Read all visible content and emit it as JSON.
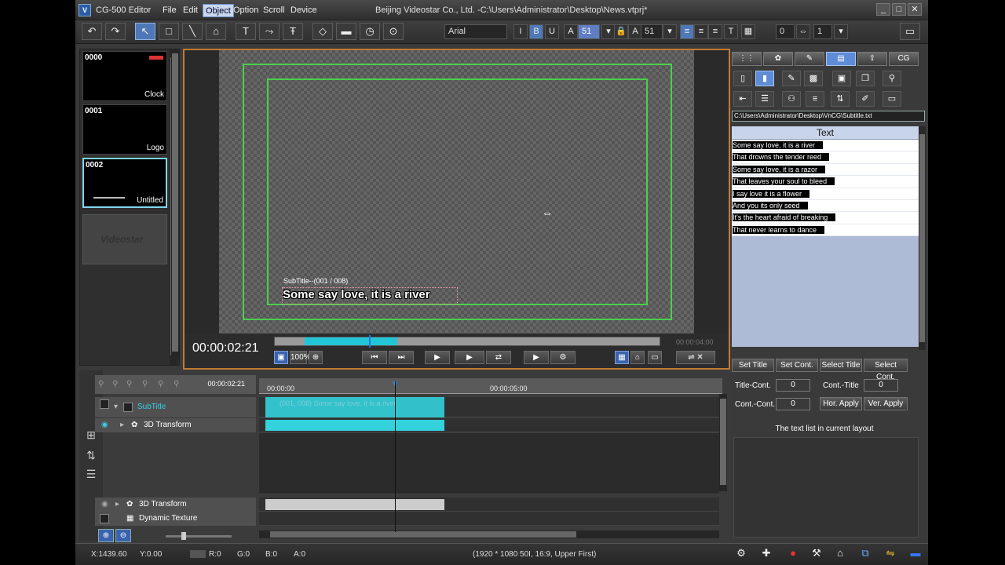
{
  "window": {
    "app_name": "CG-500 Editor",
    "doc_title": "Beijing Videostar Co., Ltd. -C:\\Users\\Administrator\\Desktop\\News.vtprj*",
    "menus": [
      "File",
      "Edit",
      "Object",
      "Option",
      "Scroll",
      "Device"
    ],
    "active_menu": "Object",
    "controls": [
      "_",
      "□",
      "✕"
    ]
  },
  "toolbar": {
    "font": "Arial",
    "bold": "B",
    "italic": "I",
    "underline": "U",
    "font_size_1": "51",
    "font_size_2": "51",
    "spacing": "0",
    "lines": "1"
  },
  "thumbnails": [
    {
      "num": "0000",
      "name": "Clock"
    },
    {
      "num": "0001",
      "name": "Logo"
    },
    {
      "num": "0002",
      "name": "Untitled"
    }
  ],
  "thumb_empty_logo": "Videostar",
  "preview": {
    "subtitle_label": "SubTitle--(001 / 008)",
    "subtitle_text": "Some say love, it is a river",
    "timecode": "00:00:02:21",
    "end_time": "00:00:04:00",
    "zoom": "100%"
  },
  "right_panel": {
    "tabs": [
      "",
      "",
      "",
      "",
      "",
      "CG"
    ],
    "path": "C:\\Users\\Administrator\\Desktop\\VnCG\\Subtitle.txt",
    "list_header": "Text",
    "text_rows": [
      "Some say love, it is a river",
      "That drowns the tender reed",
      "Some say love, it is a razor",
      "That leaves your soul to bleed",
      "I say love it is a flower",
      "And you its only seed",
      "It's the heart afraid of breaking",
      "That never learns to dance"
    ]
  },
  "controls": {
    "set_title": "Set Title",
    "set_cont": "Set Cont.",
    "select_title": "Select Title",
    "select_cont": "Select Cont.",
    "title_cont_label": "Title-Cont.",
    "title_cont_val": "0",
    "cont_title_label": "Cont.-Title",
    "cont_title_val": "0",
    "cont_cont_label": "Cont.-Cont.",
    "cont_cont_val": "0",
    "hor_apply": "Hor. Apply",
    "ver_apply": "Ver. Apply",
    "hint": "The text list in current layout"
  },
  "timeline": {
    "head_tc": "00:00:02:21",
    "ruler_start": "00:00:00",
    "ruler_mid": "00:00:05:00",
    "tracks": {
      "subtitle": "SubTitle",
      "transform_3d": "3D Transform",
      "transform_3d_b": "3D Transform",
      "dynamic_texture": "Dynamic Texture"
    },
    "clip_text": "(001, 008) Some say love, it is a river"
  },
  "status": {
    "x": "X:1439.60",
    "y": "Y:0.00",
    "r": "R:0",
    "g": "G:0",
    "b": "B:0",
    "a": "A:0",
    "format": "(1920 * 1080 50I, 16:9, Upper First)"
  }
}
